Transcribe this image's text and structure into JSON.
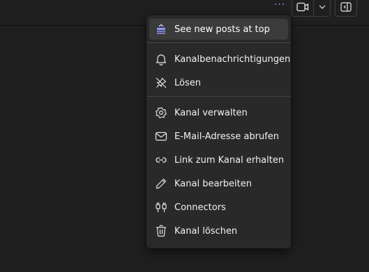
{
  "header": {
    "more_glyph": "···",
    "video_icon": "video-camera-icon",
    "dropdown_icon": "chevron-down-icon",
    "panel_icon": "open-panel-icon"
  },
  "colors": {
    "background": "#1f1f1f",
    "menu_background": "#292929",
    "highlight": "#3b3b3b",
    "accent": "#8f97f8",
    "text": "#f2f2f2"
  },
  "menu": {
    "top_item": {
      "label": "See new posts at top",
      "icon": "posts-at-top-icon"
    },
    "group_notify": [
      {
        "label": "Kanalbenachrichtigungen",
        "icon": "bell-icon"
      },
      {
        "label": "Lösen",
        "icon": "unpin-icon"
      }
    ],
    "group_manage": [
      {
        "label": "Kanal verwalten",
        "icon": "gear-icon"
      },
      {
        "label": "E-Mail-Adresse abrufen",
        "icon": "mail-icon"
      },
      {
        "label": "Link zum Kanal erhalten",
        "icon": "link-icon"
      },
      {
        "label": "Kanal bearbeiten",
        "icon": "pencil-icon"
      },
      {
        "label": "Connectors",
        "icon": "connector-plug-icon"
      },
      {
        "label": "Kanal löschen",
        "icon": "trash-icon"
      }
    ]
  }
}
